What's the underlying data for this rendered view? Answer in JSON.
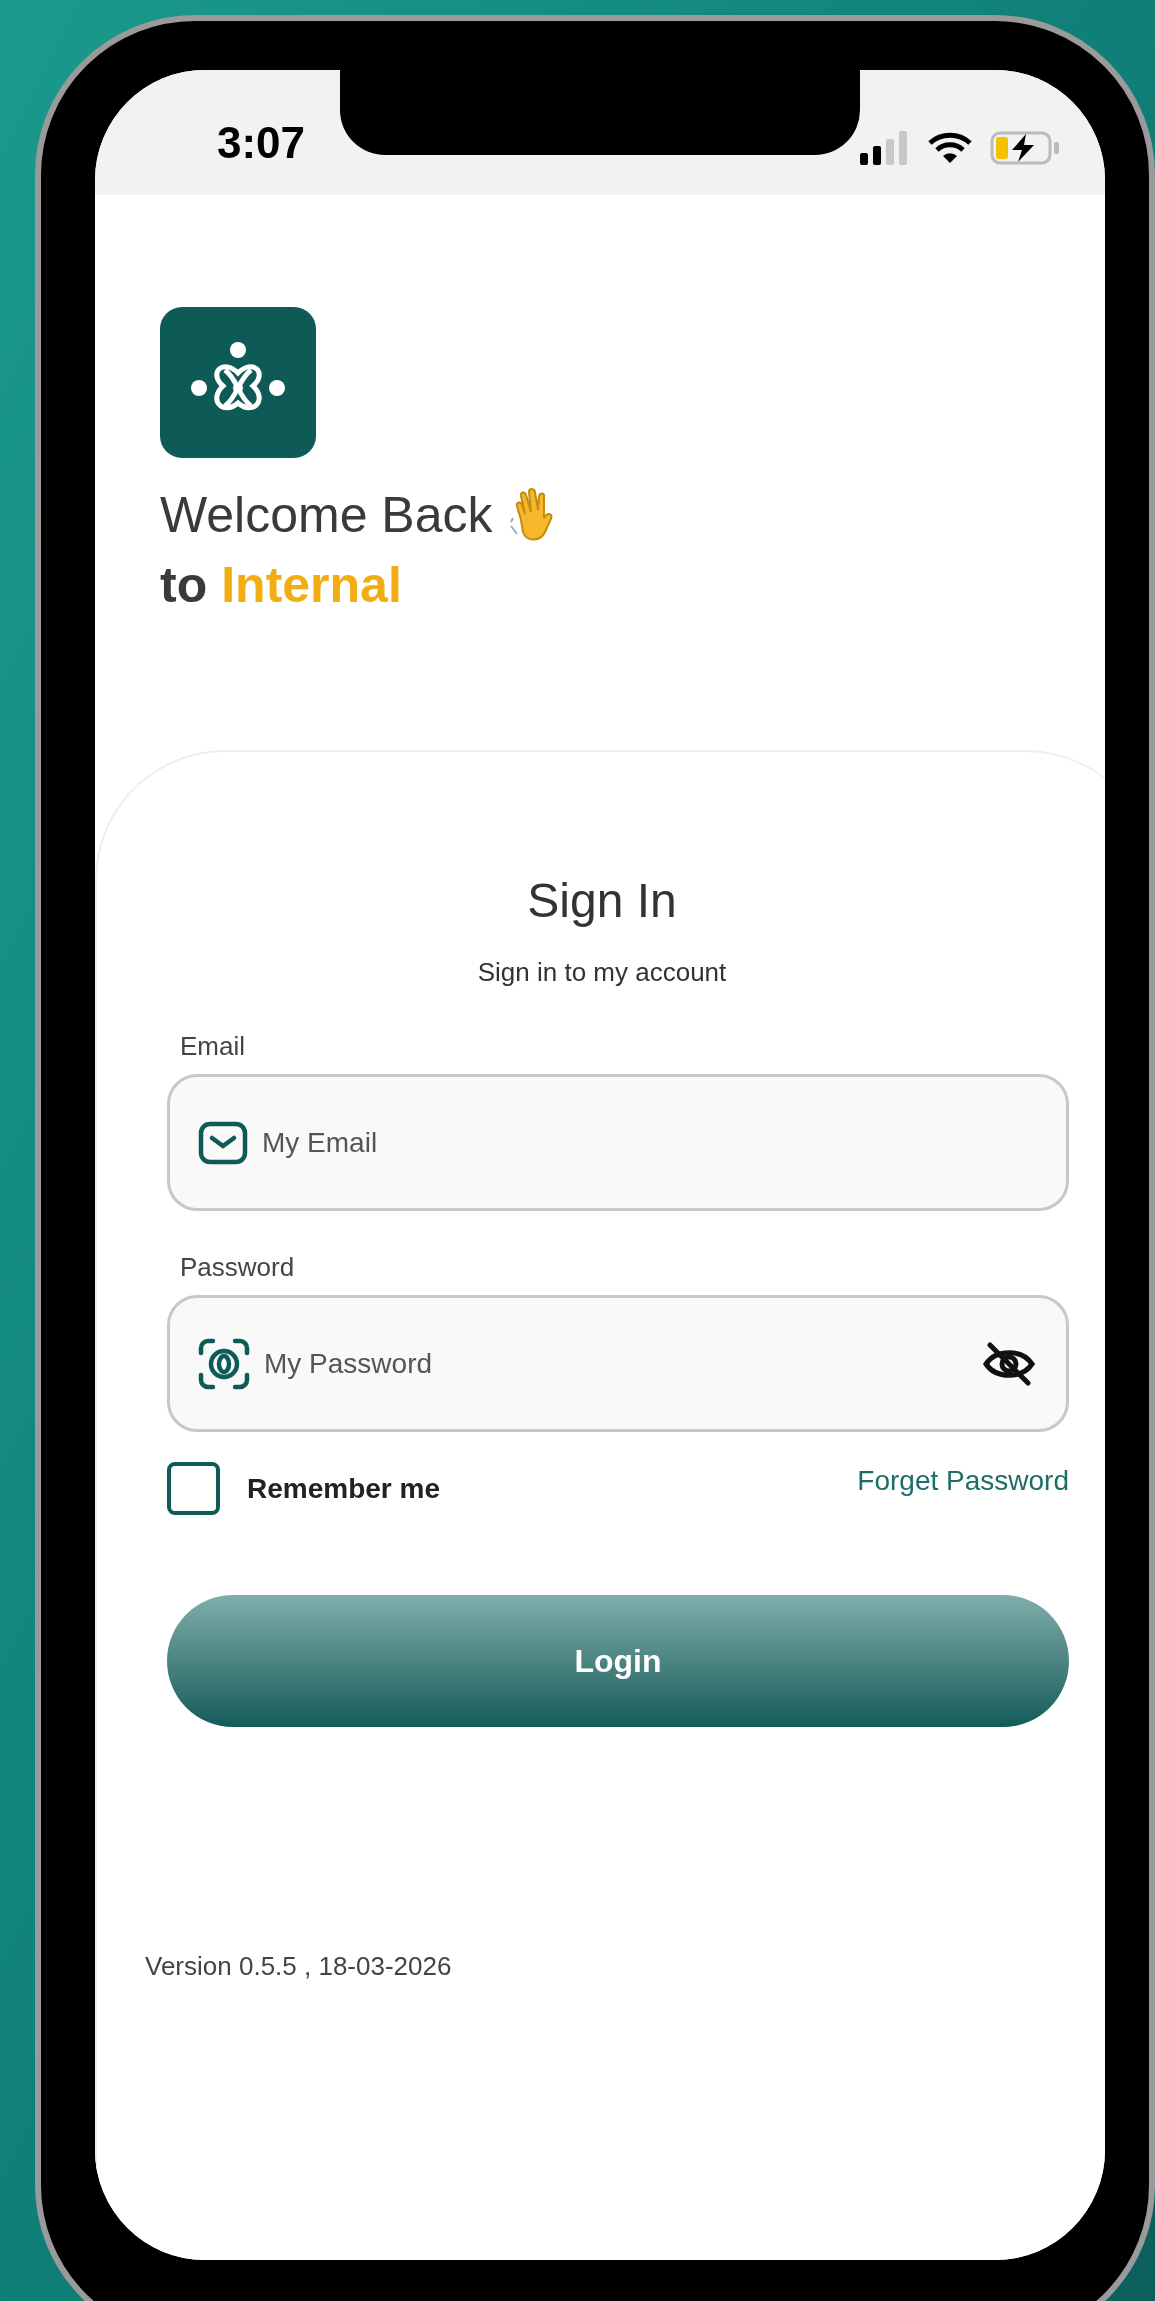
{
  "status_bar": {
    "time": "3:07"
  },
  "header": {
    "welcome": "Welcome Back",
    "to": "to",
    "brand": "Internal"
  },
  "sign_in": {
    "title": "Sign In",
    "subtitle": "Sign in to my account",
    "fields": [
      {
        "kind": "email",
        "label": "Email",
        "placeholder": "My Email"
      },
      {
        "kind": "password",
        "label": "Password",
        "placeholder": "My Password"
      }
    ],
    "remember_me": {
      "label": "Remember me",
      "checked": false
    },
    "forget_password": "Forget Password",
    "login_button": "Login"
  },
  "version": "Version 0.5.5 , 18-03-2026"
}
